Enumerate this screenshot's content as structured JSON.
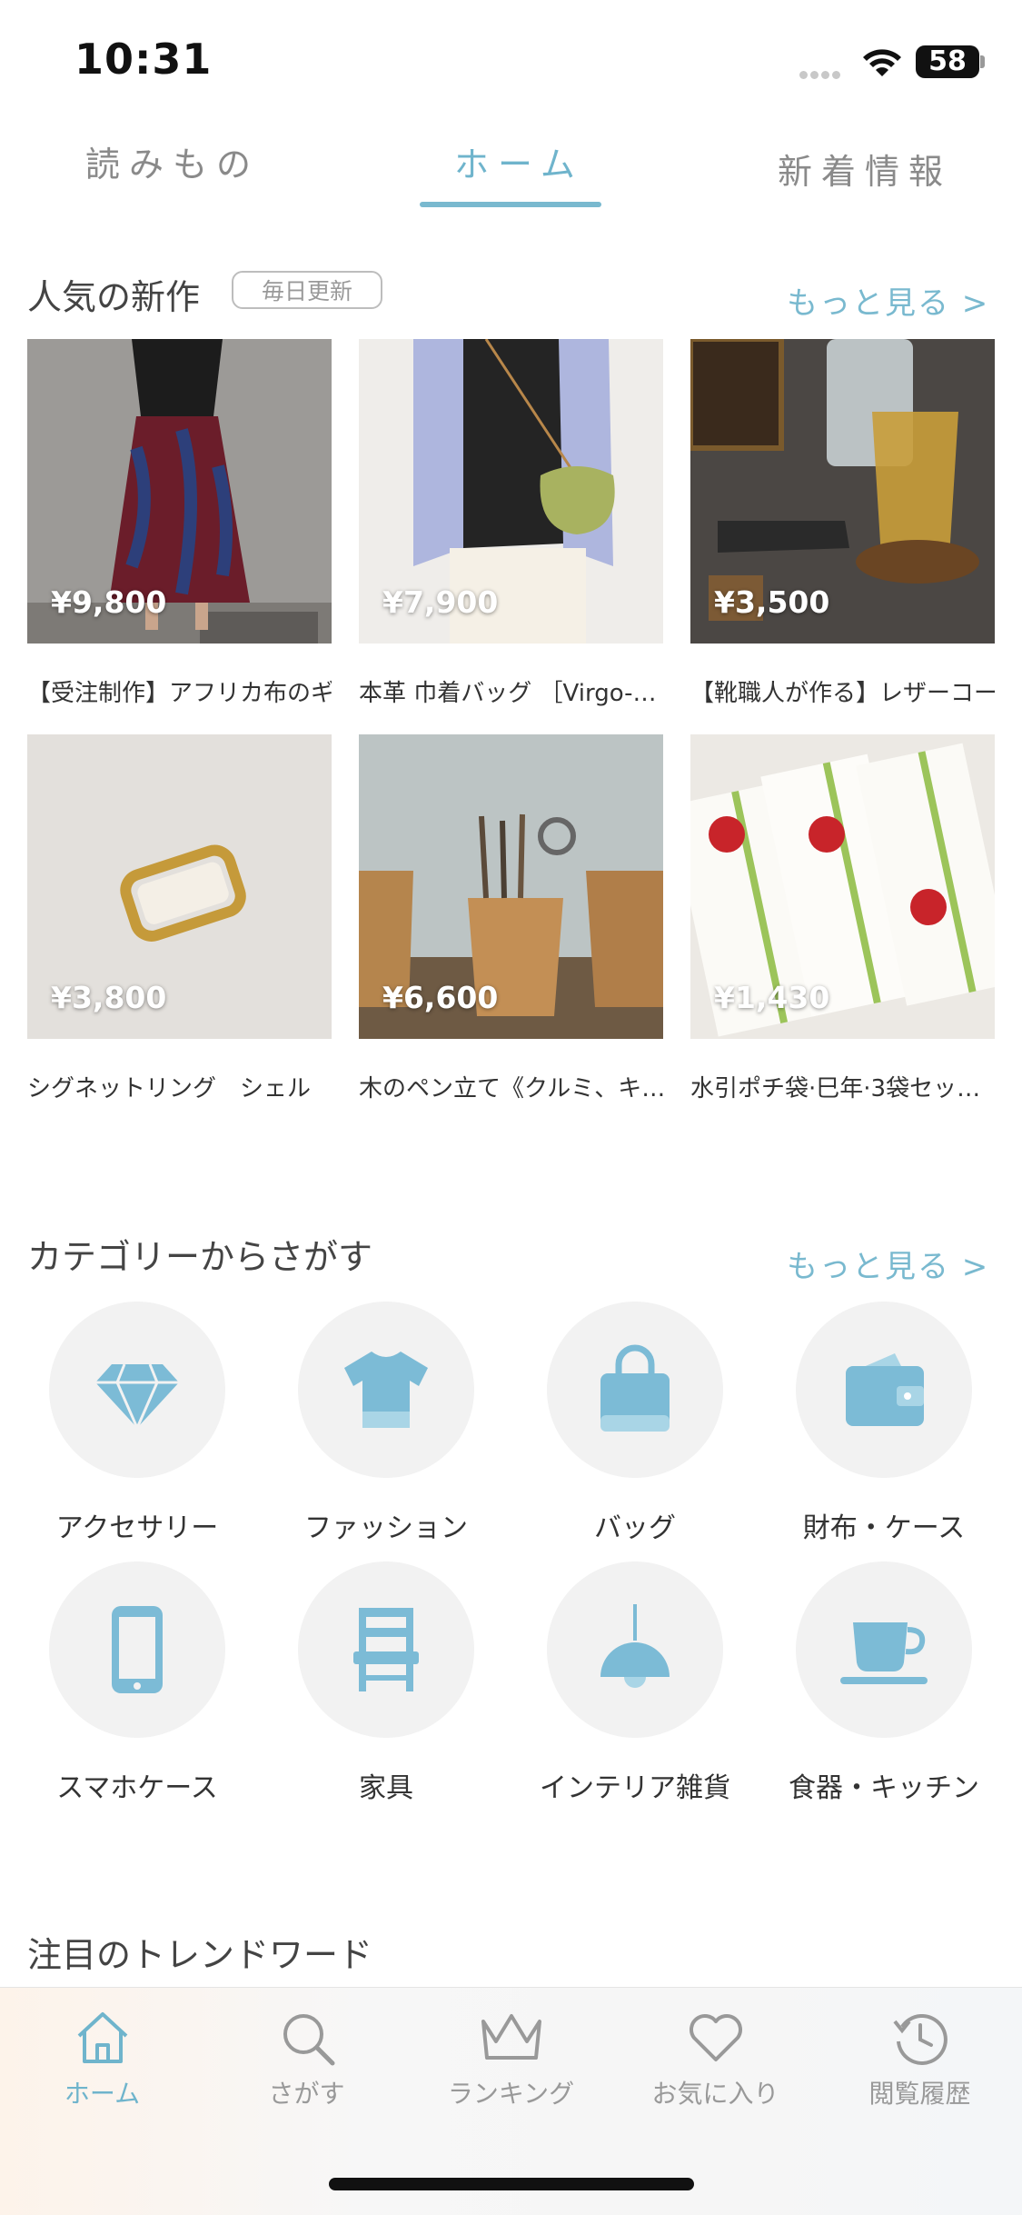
{
  "status_bar": {
    "time": "10:31",
    "battery": "58"
  },
  "top_tabs": [
    {
      "label": "読みもの",
      "active": false
    },
    {
      "label": "ホーム",
      "active": true
    },
    {
      "label": "新着情報",
      "active": false
    }
  ],
  "popular": {
    "title": "人気の新作",
    "badge": "毎日更新",
    "more": "もっと見る >",
    "items": [
      {
        "price": "¥9,800",
        "name": "【受注制作】アフリカ布のギ…"
      },
      {
        "price": "¥7,900",
        "name": "本革 巾着バッグ ［Virgo-…"
      },
      {
        "price": "¥3,500",
        "name": "【靴職人が作る】レザーコー…"
      },
      {
        "price": "¥3,800",
        "name": "シグネットリング　シェル"
      },
      {
        "price": "¥6,600",
        "name": "木のペン立て《クルミ、キ…"
      },
      {
        "price": "¥1,430",
        "name": "水引ポチ袋·巳年·3袋セッ…"
      }
    ]
  },
  "categories": {
    "title": "カテゴリーからさがす",
    "more": "もっと見る >",
    "items": [
      {
        "label": "アクセサリー",
        "icon": "diamond-icon"
      },
      {
        "label": "ファッション",
        "icon": "tshirt-icon"
      },
      {
        "label": "バッグ",
        "icon": "bag-icon"
      },
      {
        "label": "財布・ケース",
        "icon": "wallet-icon"
      },
      {
        "label": "スマホケース",
        "icon": "smartphone-icon"
      },
      {
        "label": "家具",
        "icon": "chair-icon"
      },
      {
        "label": "インテリア雑貨",
        "icon": "lamp-icon"
      },
      {
        "label": "食器・キッチン",
        "icon": "cup-icon"
      }
    ]
  },
  "trend": {
    "title": "注目のトレンドワード"
  },
  "bottom_nav": [
    {
      "label": "ホーム",
      "icon": "home-icon",
      "active": true
    },
    {
      "label": "さがす",
      "icon": "search-icon"
    },
    {
      "label": "ランキング",
      "icon": "crown-icon"
    },
    {
      "label": "お気に入り",
      "icon": "heart-icon"
    },
    {
      "label": "閲覧履歴",
      "icon": "history-icon"
    }
  ],
  "colors": {
    "accent": "#79b9cf",
    "icon_blue": "#7cbbd6",
    "circle_bg": "#f2f2f2"
  }
}
